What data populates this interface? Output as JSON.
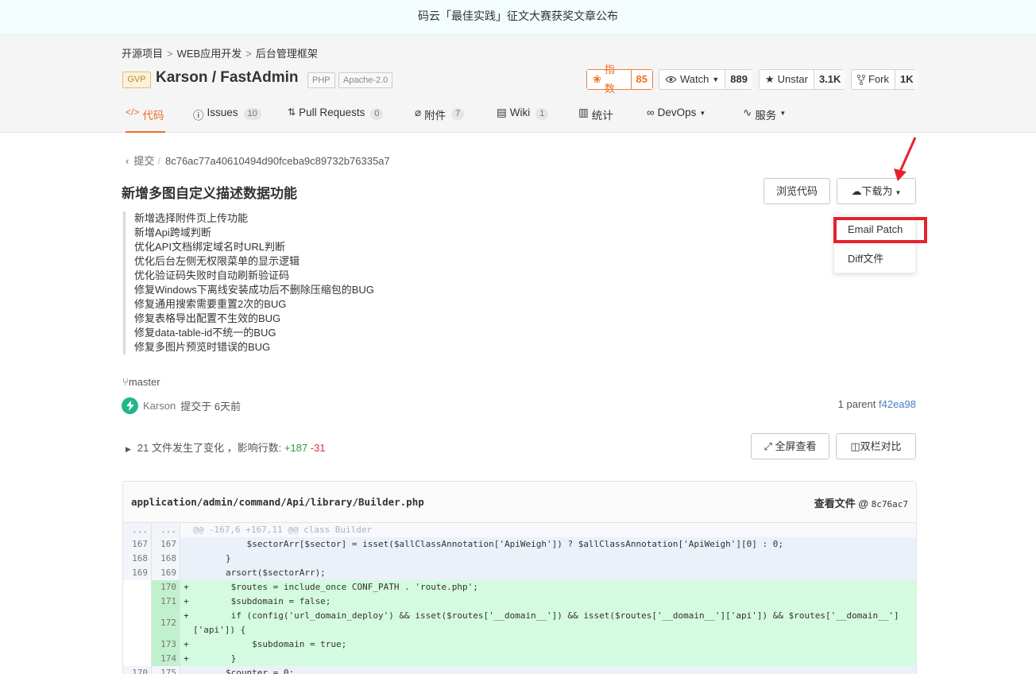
{
  "banner": {
    "text": "码云「最佳实践」征文大赛获奖文章公布"
  },
  "breadcrumb": {
    "items": [
      "开源项目",
      "WEB应用开发",
      "后台管理框架"
    ],
    "sep": ">"
  },
  "repo": {
    "gvp": "GVP",
    "title": "Karson / FastAdmin",
    "tags": [
      "PHP",
      "Apache-2.0"
    ],
    "index": {
      "label": "指数",
      "value": "85"
    },
    "watch": {
      "label": "Watch",
      "value": "889"
    },
    "unstar": {
      "label": "Unstar",
      "value": "3.1K"
    },
    "fork": {
      "label": "Fork",
      "value": "1K"
    }
  },
  "tabs": [
    {
      "label": "代码",
      "icon": "code-icon"
    },
    {
      "label": "Issues",
      "count": "10",
      "icon": "issue-icon"
    },
    {
      "label": "Pull Requests",
      "count": "0",
      "icon": "pull-request-icon"
    },
    {
      "label": "附件",
      "count": "7",
      "icon": "attachment-icon"
    },
    {
      "label": "Wiki",
      "count": "1",
      "icon": "wiki-icon"
    },
    {
      "label": "统计",
      "icon": "stats-icon"
    },
    {
      "label": "DevOps",
      "icon": "devops-icon"
    },
    {
      "label": "服务",
      "icon": "service-icon"
    }
  ],
  "commit": {
    "back_label": "提交",
    "sep": "/",
    "hash": "8c76ac77a40610494d90fceba9c89732b76335a7",
    "title": "新增多图自定义描述数据功能",
    "browse_label": "浏览代码",
    "download_label": "下载为",
    "dropdown": [
      "Email Patch",
      "Diff文件"
    ],
    "message": [
      "新增选择附件页上传功能",
      "新增Api跨域判断",
      "优化API文档绑定域名时URL判断",
      "优化后台左侧无权限菜单的显示逻辑",
      "优化验证码失败时自动刷新验证码",
      "修复Windows下离线安装成功后不删除压缩包的BUG",
      "修复通用搜索需要重置2次的BUG",
      "修复表格导出配置不生效的BUG",
      "修复data-table-id不统一的BUG",
      "修复多图片预览时错误的BUG"
    ],
    "branch": "master",
    "author": "Karson",
    "committed": "提交于 6天前",
    "parent_label": "1 parent",
    "parent_hash": "f42ea98",
    "changes_text": "21 文件发生了变化 ，影响行数: ",
    "additions": "+187",
    "deletions": "-31",
    "fullscreen_label": "全屏查看",
    "split_label": "双栏对比"
  },
  "diff": {
    "file_path": "application/admin/command/Api/library/Builder.php",
    "view_label": "查看文件 @",
    "view_hash": "8c76ac7",
    "hunk_ln": "...",
    "hunk": "@@ -167,6 +167,11 @@ class Builder",
    "lines": [
      {
        "old": "167",
        "new": "167",
        "text": "            $sectorArr[$sector] = isset($allClassAnnotation['ApiWeigh']) ? $allClassAnnotation['ApiWeigh'][0] : 0;"
      },
      {
        "old": "168",
        "new": "168",
        "text": "        }"
      },
      {
        "old": "169",
        "new": "169",
        "text": "        arsort($sectorArr);"
      },
      {
        "old": "",
        "new": "170",
        "text": "+        $routes = include_once CONF_PATH . 'route.php';"
      },
      {
        "old": "",
        "new": "171",
        "text": "+        $subdomain = false;"
      },
      {
        "old": "",
        "new": "172",
        "text": "+        if (config('url_domain_deploy') && isset($routes['__domain__']) && isset($routes['__domain__']['api']) && $routes['__domain__']",
        "cont": "['api']) {"
      },
      {
        "old": "",
        "new": "173",
        "text": "+            $subdomain = true;"
      },
      {
        "old": "",
        "new": "174",
        "text": "+        }"
      },
      {
        "old": "170",
        "new": "175",
        "text": "        $counter = 0;"
      }
    ]
  },
  "colors": {
    "accent": "#f36b28",
    "highlight": "#e8222d",
    "addition": "#d4fbdf",
    "context": "#eaf1f9"
  }
}
